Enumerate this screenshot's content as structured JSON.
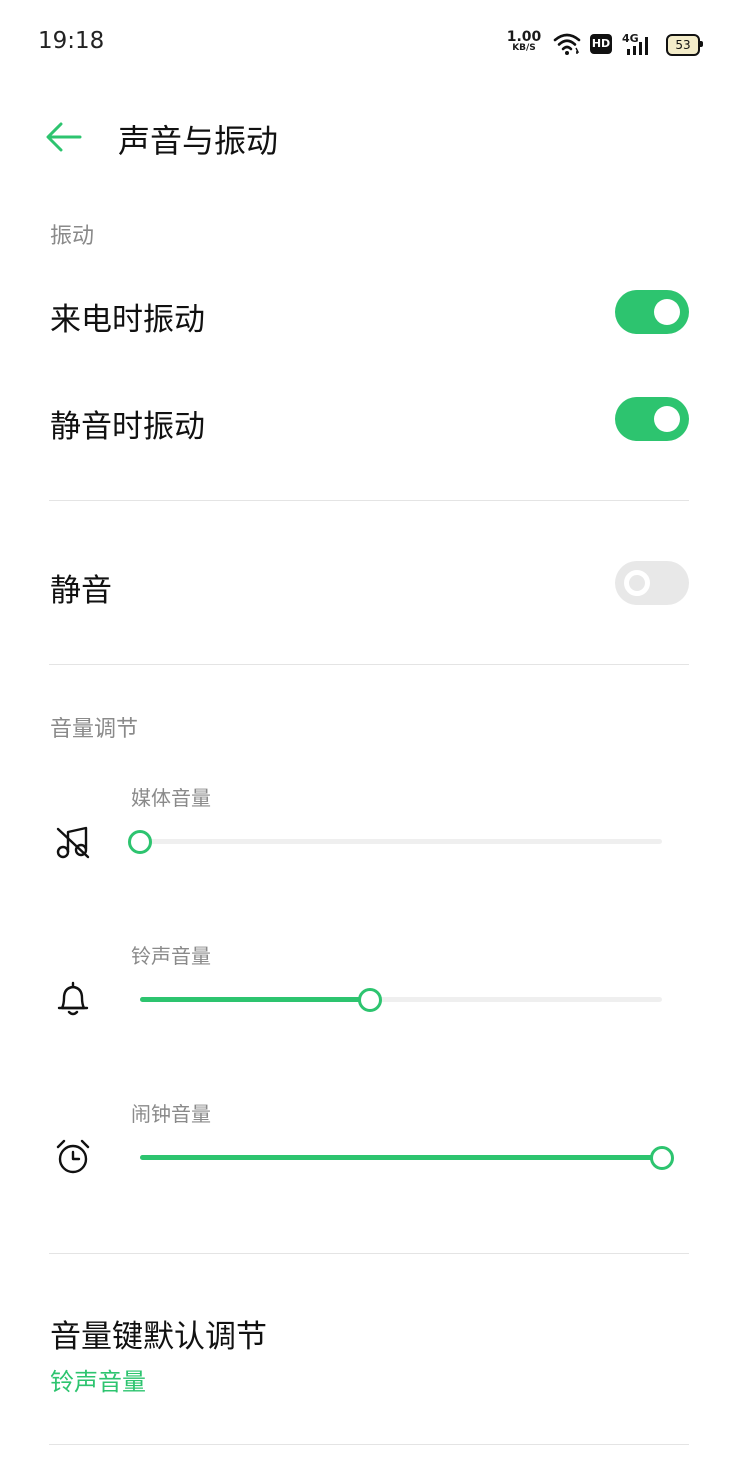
{
  "status_bar": {
    "time": "19:18",
    "net_speed": "1.00",
    "net_unit": "KB/S",
    "hd": "HD",
    "network": "4G",
    "battery": "53"
  },
  "header": {
    "title": "声音与振动"
  },
  "vibration": {
    "section_title": "振动",
    "ring_vibrate_label": "来电时振动",
    "ring_vibrate_on": true,
    "silent_vibrate_label": "静音时振动",
    "silent_vibrate_on": true
  },
  "mute": {
    "label": "静音",
    "on": false
  },
  "volume": {
    "section_title": "音量调节",
    "sliders": [
      {
        "label": "媒体音量",
        "icon": "music-muted-icon",
        "value": 0.0
      },
      {
        "label": "铃声音量",
        "icon": "bell-icon",
        "value": 0.44
      },
      {
        "label": "闹钟音量",
        "icon": "alarm-clock-icon",
        "value": 1.0
      }
    ]
  },
  "volume_key": {
    "title": "音量键默认调节",
    "value": "铃声音量"
  },
  "colors": {
    "accent": "#2dc46f",
    "toggle_off": "#e8e8e8",
    "track": "#efefef"
  }
}
